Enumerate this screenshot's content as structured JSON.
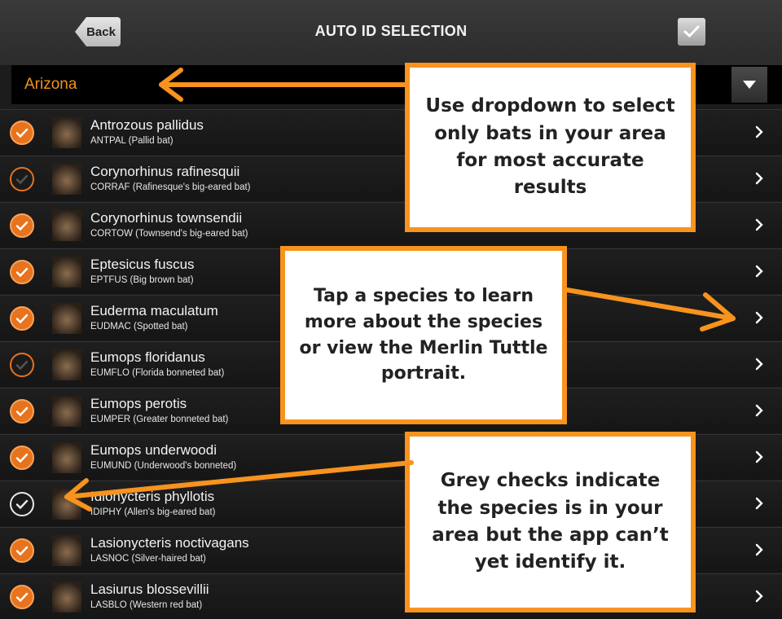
{
  "header": {
    "back_label": "Back",
    "title": "AUTO ID SELECTION"
  },
  "region": {
    "selected": "Arizona"
  },
  "species": [
    {
      "name": "Antrozous pallidus",
      "code": "ANTPAL (Pallid bat)",
      "check": "on"
    },
    {
      "name": "Corynorhinus rafinesquii",
      "code": "CORRAF (Rafinesque's big-eared bat)",
      "check": "off"
    },
    {
      "name": "Corynorhinus townsendii",
      "code": "CORTOW (Townsend's big-eared bat)",
      "check": "on"
    },
    {
      "name": "Eptesicus fuscus",
      "code": "EPTFUS (Big brown bat)",
      "check": "on"
    },
    {
      "name": "Euderma maculatum",
      "code": "EUDMAC (Spotted bat)",
      "check": "on"
    },
    {
      "name": "Eumops floridanus",
      "code": "EUMFLO (Florida bonneted bat)",
      "check": "off"
    },
    {
      "name": "Eumops perotis",
      "code": "EUMPER (Greater bonneted bat)",
      "check": "on"
    },
    {
      "name": "Eumops underwoodi",
      "code": "EUMUND (Underwood's bonneted)",
      "check": "on"
    },
    {
      "name": "Idionycteris phyllotis",
      "code": "IDIPHY (Allen's big-eared bat)",
      "check": "grey"
    },
    {
      "name": "Lasionycteris noctivagans",
      "code": "LASNOC (Silver-haired bat)",
      "check": "on"
    },
    {
      "name": "Lasiurus blossevillii",
      "code": "LASBLO (Western red bat)",
      "check": "on"
    }
  ],
  "callouts": {
    "dropdown": "Use dropdown to select only bats in your area for most accurate results",
    "tap": "Tap a species to learn more about the species or view the Merlin Tuttle portrait.",
    "grey": "Grey checks indicate the species is in your area but the app can’t yet identify it."
  },
  "colors": {
    "accent": "#f7931e",
    "check_on": "#e8731e"
  },
  "icons": {
    "back": "back-arrow-icon",
    "confirm": "checkmark-icon",
    "dropdown": "triangle-down-icon",
    "row_check": "check-circle-icon",
    "row_nav": "chevron-right-icon"
  }
}
